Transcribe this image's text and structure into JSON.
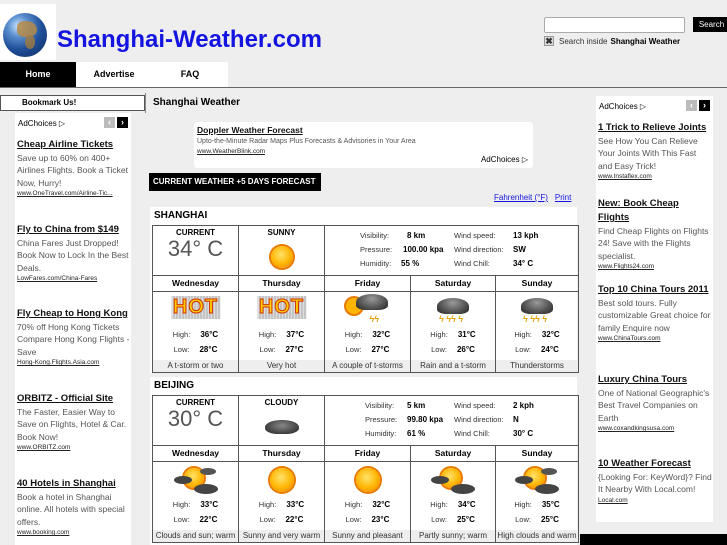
{
  "header": {
    "site_title": "Shanghai-Weather.com",
    "logo_icon": "globe-icon",
    "nav": [
      {
        "label": "Home",
        "active": true
      },
      {
        "label": "Advertise",
        "active": false
      },
      {
        "label": "FAQ",
        "active": false
      }
    ],
    "search": {
      "value": "",
      "placeholder": "",
      "button_label": "Search",
      "option_prefix": "Search inside",
      "option_site": "Shanghai Weather",
      "option_checked": true
    }
  },
  "left_sidebar": {
    "bookmark_label": "Bookmark Us!",
    "adchoices_label": "AdChoices ▷",
    "ads": [
      {
        "title": "Cheap Airline Tickets",
        "desc": "Save up to 60% on 400+ Airlines Flights. Book a Ticket Now, Hurry!",
        "url": "www.OneTravel.com/Airline-Tic..."
      },
      {
        "title": "Fly to China from $149",
        "desc": "China Fares Just Dropped! Book Now to Lock In the Best Deals.",
        "url": "LowFares.com/China-Fares"
      },
      {
        "title": "Fly Cheap to Hong Kong",
        "desc": "70% off Hong Kong Tickets Compare Hong Kong Flights - Save",
        "url": "Hong-Kong.Flights.Asia.com"
      },
      {
        "title": "ORBITZ - Official Site",
        "desc": "The Faster, Easier Way to Save on Flights, Hotel & Car. Book Now!",
        "url": "www.ORBITZ.com"
      },
      {
        "title": "40 Hotels in Shanghai",
        "desc": "Book a hotel in Shanghai online. All hotels with special offers.",
        "url": "www.booking.com"
      }
    ]
  },
  "right_sidebar": {
    "adchoices_label": "AdChoices ▷",
    "ads": [
      {
        "title": "1 Trick to Relieve Joints",
        "desc": "See How You Can Relieve Your Joints With This Fast and Easy Trick!",
        "url": "www.Instaflex.com"
      },
      {
        "title": "New: Book Cheap Flights",
        "desc": "Find Cheap Flights on Flights 24! Save with the Flights specialist.",
        "url": "www.Flights24.com"
      },
      {
        "title": "Top 10 China Tours 2011",
        "desc": "Best sold tours. Fully customizable Great choice for family Enquire now",
        "url": "www.ChinaTours.com"
      },
      {
        "title": "Luxury China Tours",
        "desc": "One of National Geographic's Best Travel Companies on Earth",
        "url": "www.coxandkingsusa.com"
      },
      {
        "title": "10 Weather Forecast",
        "desc": "{Looking For: KeyWord}? Find It Nearby With Local.com!",
        "url": "Local.com"
      }
    ]
  },
  "main": {
    "title": "Shanghai Weather",
    "top_ad": {
      "title": "Doppler Weather Forecast",
      "desc": "Upto-the-Minute Radar Maps Plus Forecasts & Advisories in Your Area",
      "url": "www.WeatherBlink.com",
      "adchoices": "AdChoices ▷"
    },
    "section_label": "CURRENT WEATHER +5 DAYS FORECAST",
    "links": {
      "fahrenheit": "Fahrenheit (°F)",
      "print": "Print"
    },
    "labels": {
      "current": "CURRENT",
      "visibility": "Visibility:",
      "pressure": "Pressure:",
      "humidity": "Humidity:",
      "wind_speed": "Wind speed:",
      "wind_direction": "Wind direction:",
      "wind_chill": "Wind Chill:",
      "high": "High:",
      "low": "Low:"
    },
    "cities": [
      {
        "name": "SHANGHAI",
        "current_temp": "34° C",
        "condition": "SUNNY",
        "condition_icon": "sun-icon",
        "visibility": "8 km",
        "pressure": "100.00 kpa",
        "humidity": "55 %",
        "wind_speed": "13 kph",
        "wind_direction": "SW",
        "wind_chill": "34° C",
        "forecast": [
          {
            "day": "Wednesday",
            "icon": "hot-icon",
            "high": "36°C",
            "low": "28°C",
            "desc": "A t-storm or two"
          },
          {
            "day": "Thursday",
            "icon": "hot-icon",
            "high": "37°C",
            "low": "27°C",
            "desc": "Very hot"
          },
          {
            "day": "Friday",
            "icon": "sun-storm-icon",
            "high": "32°C",
            "low": "27°C",
            "desc": "A couple of t-storms"
          },
          {
            "day": "Saturday",
            "icon": "thunderstorm-icon",
            "high": "31°C",
            "low": "26°C",
            "desc": "Rain and a t-storm"
          },
          {
            "day": "Sunday",
            "icon": "thunderstorm-icon",
            "high": "32°C",
            "low": "24°C",
            "desc": "Thunderstorms"
          }
        ]
      },
      {
        "name": "BEIJING",
        "current_temp": "30° C",
        "condition": "CLOUDY",
        "condition_icon": "cloud-icon",
        "visibility": "5 km",
        "pressure": "99.80 kpa",
        "humidity": "61 %",
        "wind_speed": "2 kph",
        "wind_direction": "N",
        "wind_chill": "30° C",
        "forecast": [
          {
            "day": "Wednesday",
            "icon": "partly-cloudy-icon",
            "high": "33°C",
            "low": "22°C",
            "desc": "Clouds and sun; warm"
          },
          {
            "day": "Thursday",
            "icon": "sun-icon",
            "high": "33°C",
            "low": "22°C",
            "desc": "Sunny and very warm"
          },
          {
            "day": "Friday",
            "icon": "sun-icon",
            "high": "32°C",
            "low": "23°C",
            "desc": "Sunny and pleasant"
          },
          {
            "day": "Saturday",
            "icon": "partly-cloudy-icon",
            "high": "34°C",
            "low": "25°C",
            "desc": "Partly sunny; warm"
          },
          {
            "day": "Sunday",
            "icon": "partly-cloudy-icon",
            "high": "35°C",
            "low": "25°C",
            "desc": "High clouds and warm"
          }
        ]
      }
    ]
  }
}
